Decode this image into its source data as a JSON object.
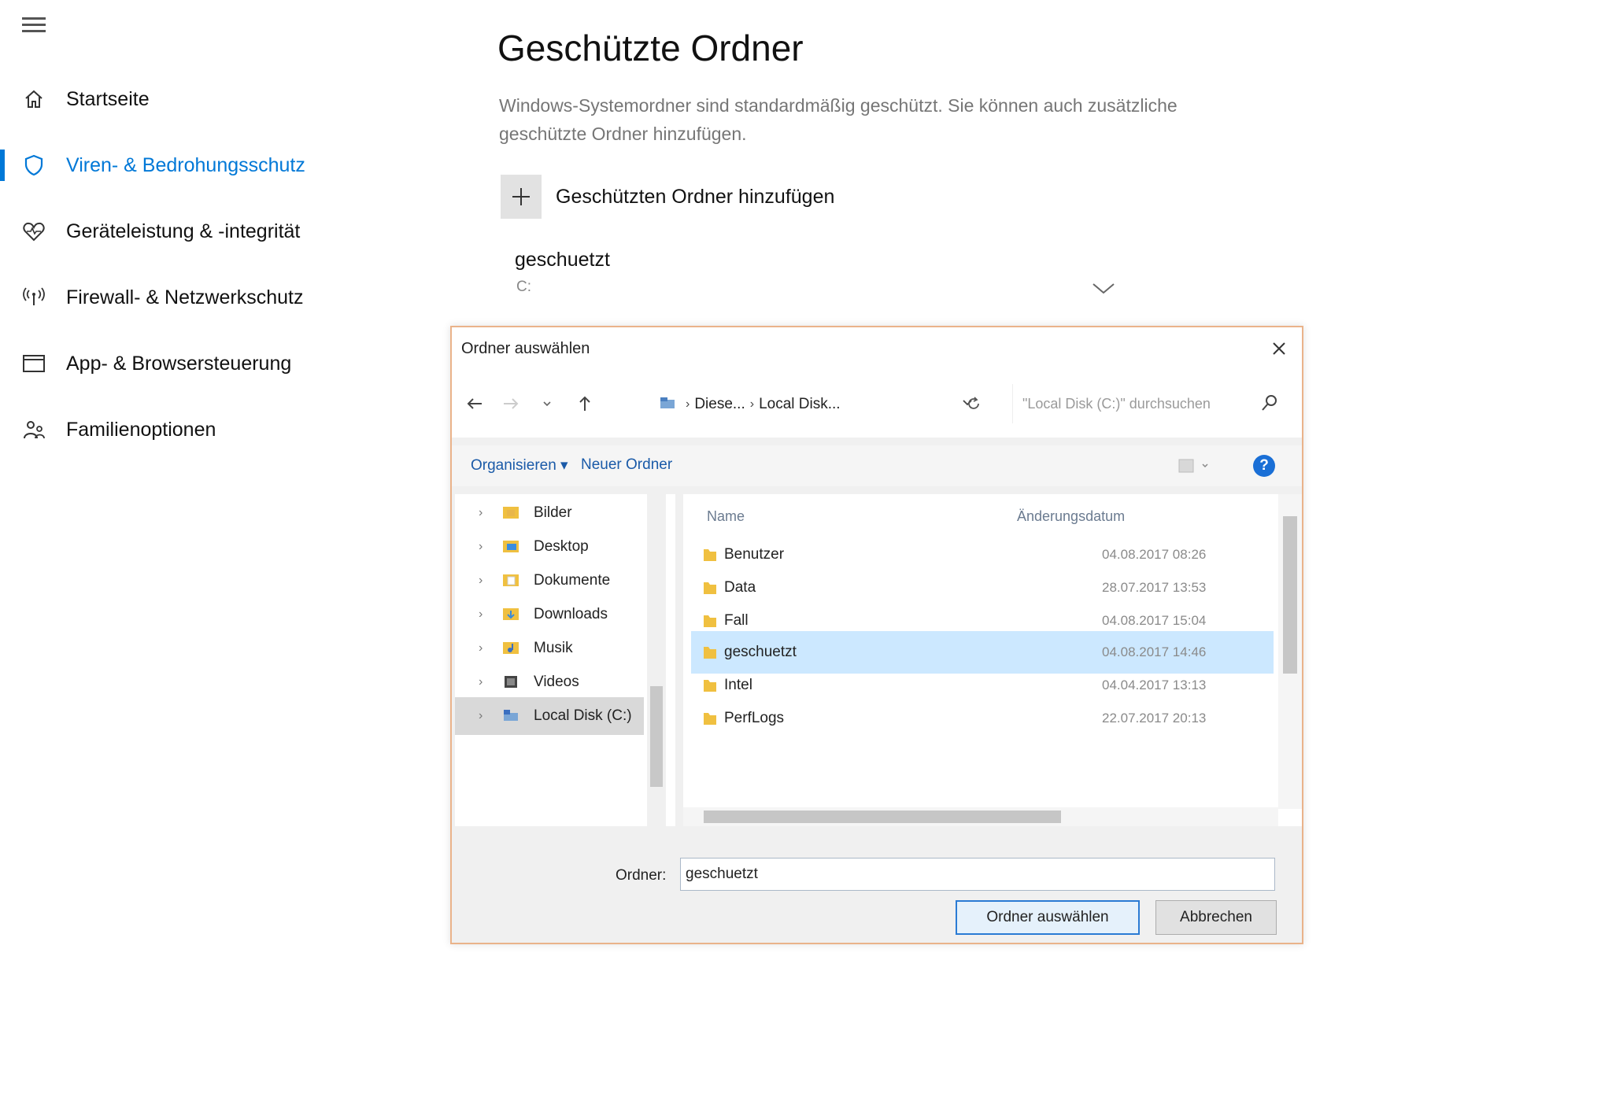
{
  "sidebar": {
    "items": [
      {
        "label": "Startseite",
        "icon": "home-icon"
      },
      {
        "label": "Viren- & Bedrohungsschutz",
        "icon": "shield-icon",
        "active": true
      },
      {
        "label": "Geräteleistung & -integrität",
        "icon": "heart-icon"
      },
      {
        "label": "Firewall- & Netzwerkschutz",
        "icon": "wifi-icon"
      },
      {
        "label": "App- & Browsersteuerung",
        "icon": "window-icon"
      },
      {
        "label": "Familienoptionen",
        "icon": "family-icon"
      }
    ]
  },
  "main": {
    "title": "Geschützte Ordner",
    "description": "Windows-Systemordner sind standardmäßig geschützt. Sie können auch zusätzliche geschützte Ordner hinzufügen.",
    "add_label": "Geschützten Ordner hinzufügen",
    "folder_name": "geschuetzt",
    "folder_path": "C:"
  },
  "dialog": {
    "title": "Ordner auswählen",
    "breadcrumb": [
      "Diese...",
      "Local Disk..."
    ],
    "search_placeholder": "\"Local Disk (C:)\" durchsuchen",
    "toolbar": {
      "organize": "Organisieren ▾",
      "new_folder": "Neuer Ordner"
    },
    "tree": [
      {
        "label": "Bilder",
        "color": "#e8b64a"
      },
      {
        "label": "Desktop",
        "color": "#3b8de0"
      },
      {
        "label": "Dokumente",
        "color": "#e8c46a"
      },
      {
        "label": "Downloads",
        "color": "#3a8ad8"
      },
      {
        "label": "Musik",
        "color": "#e8a23a"
      },
      {
        "label": "Videos",
        "color": "#444444"
      },
      {
        "label": "Local Disk (C:)",
        "color": "#5a8fc8",
        "selected": true
      }
    ],
    "columns": {
      "name": "Name",
      "date": "Änderungsdatum"
    },
    "files": [
      {
        "name": "Benutzer",
        "date": "04.08.2017 08:26"
      },
      {
        "name": "Data",
        "date": "28.07.2017 13:53"
      },
      {
        "name": "Fall",
        "date": "04.08.2017 15:04"
      },
      {
        "name": "geschuetzt",
        "date": "04.08.2017 14:46",
        "selected": true
      },
      {
        "name": "Intel",
        "date": "04.04.2017 13:13"
      },
      {
        "name": "PerfLogs",
        "date": "22.07.2017 20:13"
      }
    ],
    "folder_label": "Ordner:",
    "folder_value": "geschuetzt",
    "select_button": "Ordner auswählen",
    "cancel_button": "Abbrechen"
  },
  "colors": {
    "accent": "#0078d7",
    "folder": "#f0c040",
    "selection": "#cce8ff"
  }
}
